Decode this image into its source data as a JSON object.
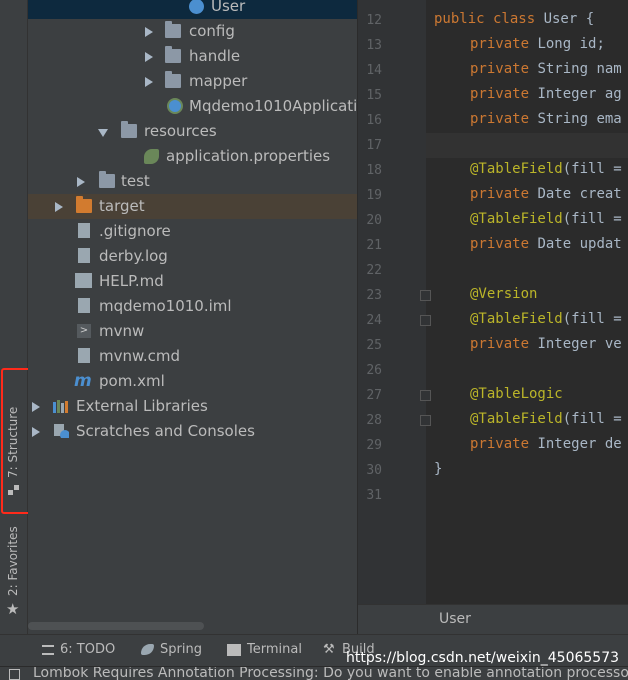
{
  "tree": {
    "items": [
      {
        "label": "User",
        "icon": "class-icon"
      },
      {
        "label": "config",
        "icon": "package-icon"
      },
      {
        "label": "handle",
        "icon": "package-icon"
      },
      {
        "label": "mapper",
        "icon": "package-icon"
      },
      {
        "label": "Mqdemo1010Applicati",
        "icon": "spring-app-icon"
      },
      {
        "label": "resources",
        "icon": "resources-folder-icon"
      },
      {
        "label": "application.properties",
        "icon": "spring-properties-icon"
      },
      {
        "label": "test",
        "icon": "folder-icon"
      },
      {
        "label": "target",
        "icon": "excluded-folder-icon"
      },
      {
        "label": ".gitignore",
        "icon": "file-icon"
      },
      {
        "label": "derby.log",
        "icon": "file-icon"
      },
      {
        "label": "HELP.md",
        "icon": "markdown-icon"
      },
      {
        "label": "mqdemo1010.iml",
        "icon": "module-file-icon"
      },
      {
        "label": "mvnw",
        "icon": "shell-icon"
      },
      {
        "label": "mvnw.cmd",
        "icon": "file-icon"
      },
      {
        "label": "pom.xml",
        "icon": "maven-icon"
      },
      {
        "label": "External Libraries",
        "icon": "libraries-icon"
      },
      {
        "label": "Scratches and Consoles",
        "icon": "scratches-icon"
      }
    ]
  },
  "sidebar": {
    "structure": "7: Structure",
    "favorites": "2: Favorites"
  },
  "editor": {
    "tab": "User",
    "lines": [
      {
        "n": "12",
        "kw": "public class ",
        "rest": "User {",
        "ann": ""
      },
      {
        "n": "13",
        "kw": "private ",
        "rest": "Long id;",
        "ann": ""
      },
      {
        "n": "14",
        "kw": "private ",
        "rest": "String nam",
        "ann": ""
      },
      {
        "n": "15",
        "kw": "private ",
        "rest": "Integer ag",
        "ann": ""
      },
      {
        "n": "16",
        "kw": "private ",
        "rest": "String ema",
        "ann": ""
      },
      {
        "n": "17",
        "kw": "",
        "rest": "",
        "ann": ""
      },
      {
        "n": "18",
        "kw": "",
        "rest": "(fill =",
        "ann": "@TableField"
      },
      {
        "n": "19",
        "kw": "private ",
        "rest": "Date creat",
        "ann": ""
      },
      {
        "n": "20",
        "kw": "",
        "rest": "(fill =",
        "ann": "@TableField"
      },
      {
        "n": "21",
        "kw": "private ",
        "rest": "Date updat",
        "ann": ""
      },
      {
        "n": "22",
        "kw": "",
        "rest": "",
        "ann": ""
      },
      {
        "n": "23",
        "kw": "",
        "rest": "",
        "ann": "@Version"
      },
      {
        "n": "24",
        "kw": "",
        "rest": "(fill =",
        "ann": "@TableField"
      },
      {
        "n": "25",
        "kw": "private ",
        "rest": "Integer ve",
        "ann": ""
      },
      {
        "n": "26",
        "kw": "",
        "rest": "",
        "ann": ""
      },
      {
        "n": "27",
        "kw": "",
        "rest": "",
        "ann": "@TableLogic"
      },
      {
        "n": "28",
        "kw": "",
        "rest": "(fill =",
        "ann": "@TableField"
      },
      {
        "n": "29",
        "kw": "private ",
        "rest": "Integer de",
        "ann": ""
      },
      {
        "n": "30",
        "kw": "",
        "rest": "}",
        "ann": ""
      },
      {
        "n": "31",
        "kw": "",
        "rest": "",
        "ann": ""
      }
    ]
  },
  "bottom": {
    "todo": "6: TODO",
    "spring": "Spring",
    "terminal": "Terminal",
    "build": "Build"
  },
  "status": {
    "message": "Lombok Requires Annotation Processing: Do you want to enable annotation processors?"
  },
  "watermark": "https://blog.csdn.net/weixin_45065573"
}
